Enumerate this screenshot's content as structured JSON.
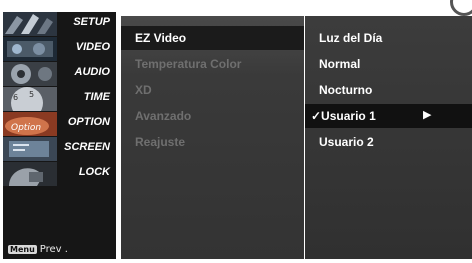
{
  "sidebar": {
    "items": [
      {
        "label": "SETUP",
        "icon": "setup-icon"
      },
      {
        "label": "VIDEO",
        "icon": "video-icon"
      },
      {
        "label": "AUDIO",
        "icon": "audio-icon"
      },
      {
        "label": "TIME",
        "icon": "time-icon"
      },
      {
        "label": "OPTION",
        "icon": "option-icon"
      },
      {
        "label": "SCREEN",
        "icon": "screen-icon"
      },
      {
        "label": "LOCK",
        "icon": "lock-icon"
      }
    ],
    "prev_key": "Menu",
    "prev_label": "Prev ."
  },
  "video_menu": {
    "items": [
      {
        "label": "EZ Video",
        "state": "selected"
      },
      {
        "label": "Temperatura Color",
        "state": "dim"
      },
      {
        "label": "XD",
        "state": "dim"
      },
      {
        "label": "Avanzado",
        "state": "dim"
      },
      {
        "label": "Reajuste",
        "state": "dim"
      }
    ]
  },
  "ez_video": {
    "items": [
      {
        "label": "Luz del Día"
      },
      {
        "label": "Normal"
      },
      {
        "label": "Nocturno"
      },
      {
        "label": "✓Usuario 1",
        "selected": true,
        "arrow": "▶"
      },
      {
        "label": "Usuario 2"
      }
    ]
  },
  "colors": {
    "panel": "#333333",
    "highlight": "#111111",
    "dim_text": "#6f6f6f"
  }
}
